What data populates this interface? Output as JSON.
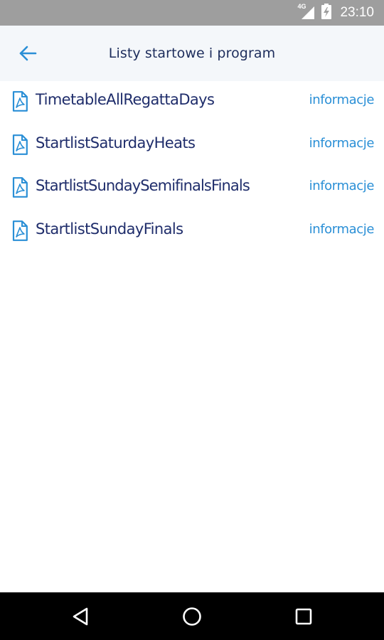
{
  "status_bar": {
    "network_label": "4G",
    "time": "23:10",
    "icons": [
      "signal-icon",
      "battery-charging-icon"
    ],
    "color": "#9e9e9e"
  },
  "app_bar": {
    "title": "Listy startowe i program",
    "back_icon": "arrow-left-icon",
    "background": "#f4f7fa",
    "accent": "#2a8fd6"
  },
  "documents": [
    {
      "name": "TimetableAllRegattaDays",
      "info_label": "informacje",
      "icon": "pdf-file-icon"
    },
    {
      "name": "StartlistSaturdayHeats",
      "info_label": "informacje",
      "icon": "pdf-file-icon"
    },
    {
      "name": "StartlistSundaySemifinalsFinals",
      "info_label": "informacje",
      "icon": "pdf-file-icon"
    },
    {
      "name": "StartlistSundayFinals",
      "info_label": "informacje",
      "icon": "pdf-file-icon"
    }
  ],
  "nav_bar": {
    "buttons": [
      "back-triangle-icon",
      "home-circle-icon",
      "recents-square-icon"
    ]
  },
  "colors": {
    "title_text": "#1d2d5c",
    "item_text": "#1f2d6b",
    "link_text": "#2a8fd6",
    "icon": "#2a8fd6"
  }
}
